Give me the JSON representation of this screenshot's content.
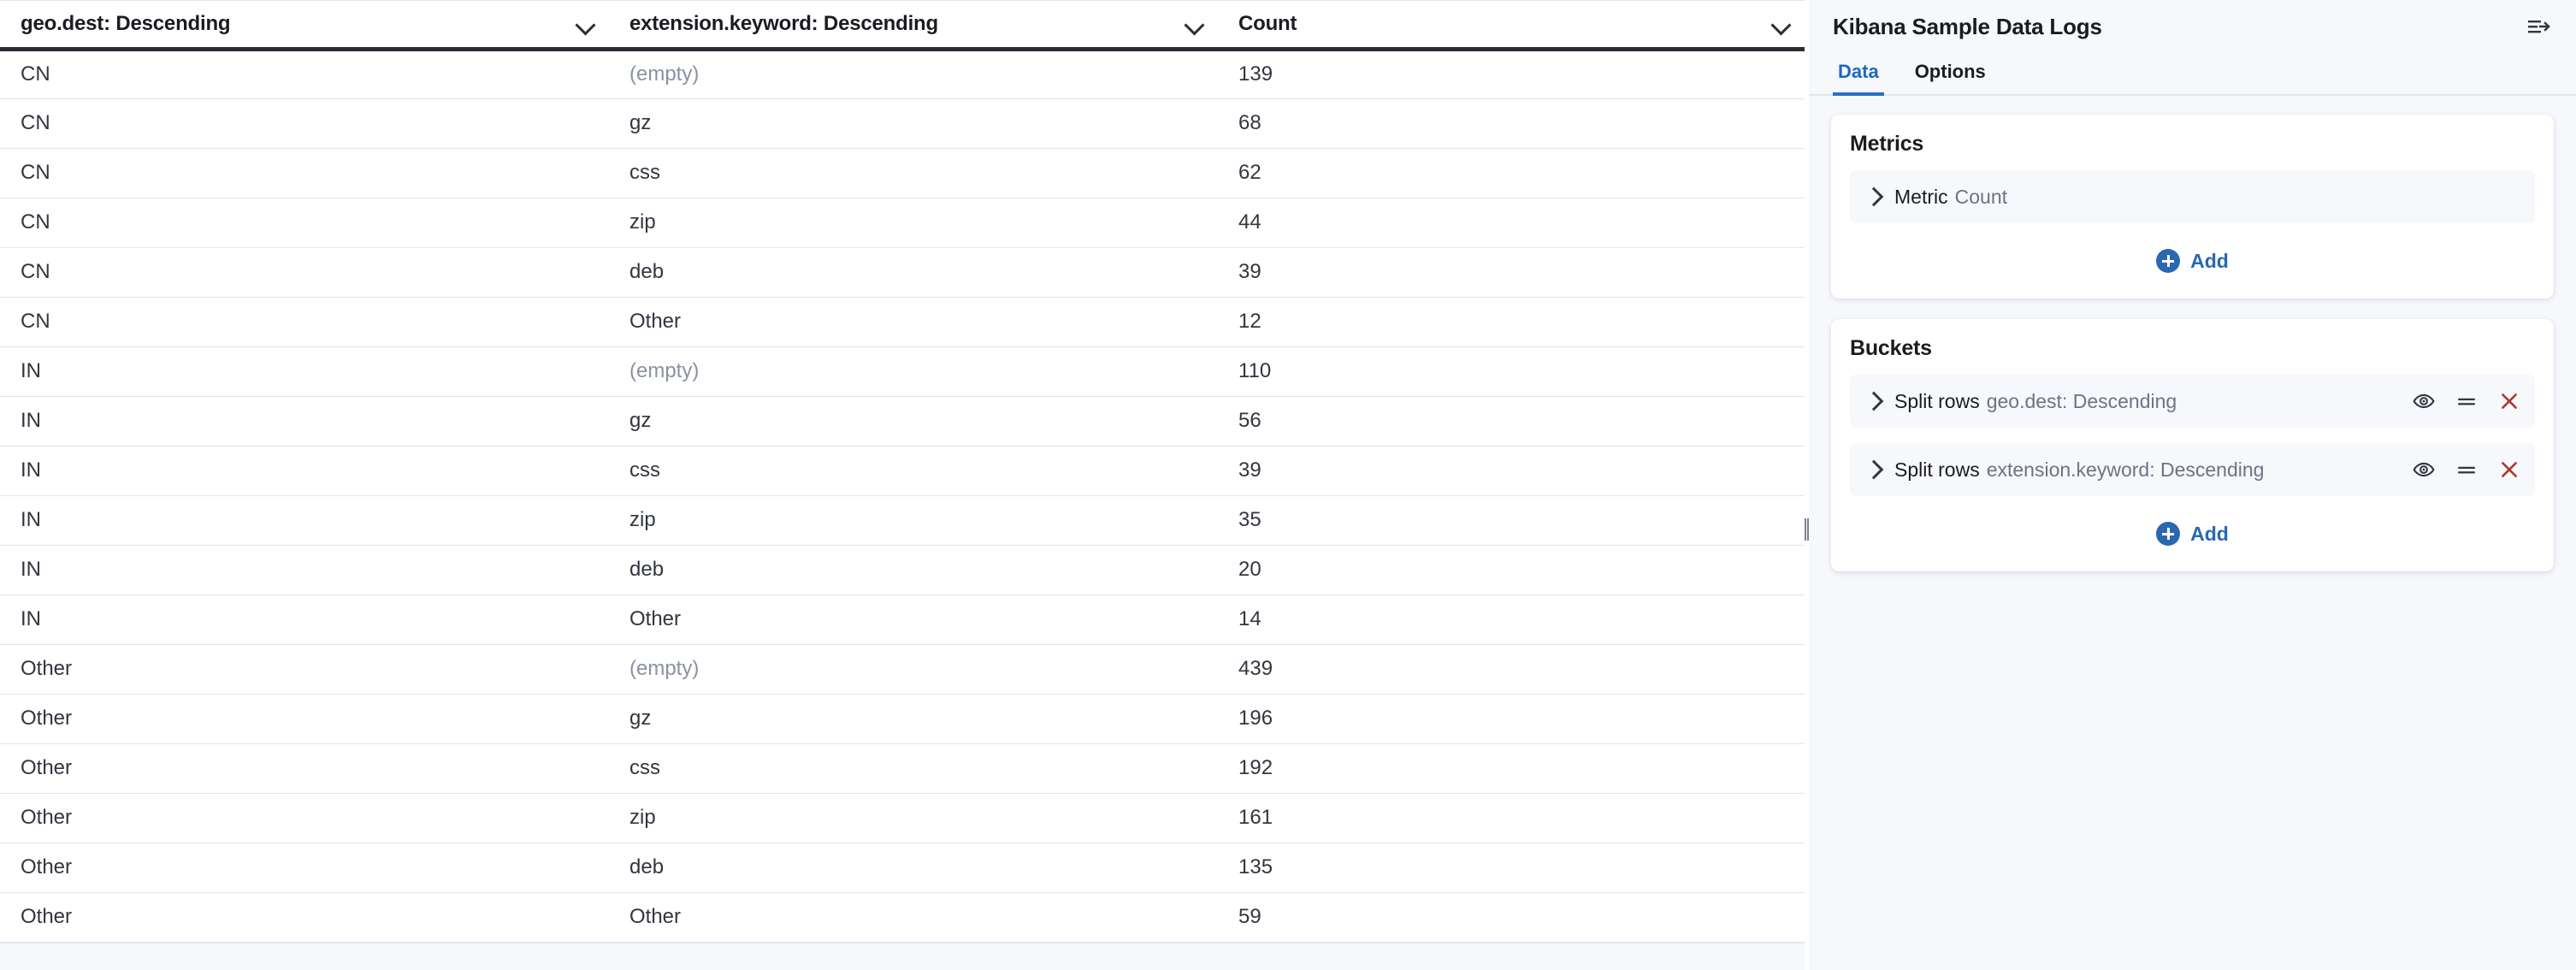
{
  "table": {
    "columns": [
      {
        "label": "geo.dest: Descending",
        "sort_icon": "chevron-down-icon"
      },
      {
        "label": "extension.keyword: Descending",
        "sort_icon": "chevron-down-icon"
      },
      {
        "label": "Count",
        "sort_icon": "chevron-down-icon"
      }
    ],
    "rows": [
      {
        "geo": "CN",
        "extension": "(empty)",
        "count": "139",
        "empty": true
      },
      {
        "geo": "CN",
        "extension": "gz",
        "count": "68",
        "empty": false
      },
      {
        "geo": "CN",
        "extension": "css",
        "count": "62",
        "empty": false
      },
      {
        "geo": "CN",
        "extension": "zip",
        "count": "44",
        "empty": false
      },
      {
        "geo": "CN",
        "extension": "deb",
        "count": "39",
        "empty": false
      },
      {
        "geo": "CN",
        "extension": "Other",
        "count": "12",
        "empty": false
      },
      {
        "geo": "IN",
        "extension": "(empty)",
        "count": "110",
        "empty": true
      },
      {
        "geo": "IN",
        "extension": "gz",
        "count": "56",
        "empty": false
      },
      {
        "geo": "IN",
        "extension": "css",
        "count": "39",
        "empty": false
      },
      {
        "geo": "IN",
        "extension": "zip",
        "count": "35",
        "empty": false
      },
      {
        "geo": "IN",
        "extension": "deb",
        "count": "20",
        "empty": false
      },
      {
        "geo": "IN",
        "extension": "Other",
        "count": "14",
        "empty": false
      },
      {
        "geo": "Other",
        "extension": "(empty)",
        "count": "439",
        "empty": true
      },
      {
        "geo": "Other",
        "extension": "gz",
        "count": "196",
        "empty": false
      },
      {
        "geo": "Other",
        "extension": "css",
        "count": "192",
        "empty": false
      },
      {
        "geo": "Other",
        "extension": "zip",
        "count": "161",
        "empty": false
      },
      {
        "geo": "Other",
        "extension": "deb",
        "count": "135",
        "empty": false
      },
      {
        "geo": "Other",
        "extension": "Other",
        "count": "59",
        "empty": false
      }
    ]
  },
  "config": {
    "title": "Kibana Sample Data Logs",
    "collapse_icon": "collapse-panel-icon",
    "tabs": [
      {
        "label": "Data",
        "active": true
      },
      {
        "label": "Options",
        "active": false
      }
    ],
    "metrics": {
      "title": "Metrics",
      "items": [
        {
          "label": "Metric",
          "value": "Count",
          "expand_icon": "chevron-right-icon"
        }
      ],
      "add_label": "Add",
      "add_icon": "plus-circle-icon"
    },
    "buckets": {
      "title": "Buckets",
      "items": [
        {
          "label": "Split rows",
          "value": "geo.dest: Descending",
          "expand_icon": "chevron-right-icon",
          "actions": [
            "eye-icon",
            "drag-handle-icon",
            "remove-icon"
          ]
        },
        {
          "label": "Split rows",
          "value": "extension.keyword: Descending",
          "expand_icon": "chevron-right-icon",
          "actions": [
            "eye-icon",
            "drag-handle-icon",
            "remove-icon"
          ]
        }
      ],
      "add_label": "Add",
      "add_icon": "plus-circle-icon"
    }
  },
  "colors": {
    "accent_blue": "#2a67b1",
    "tab_active_blue": "#1c68c4",
    "remove_red": "#a83a30",
    "text_dark": "#1a1c21",
    "text_muted": "#6d7384",
    "panel_bg": "#f7f8fc",
    "row_border": "#dfe5f0"
  },
  "chart_data": {
    "type": "table",
    "title": "Kibana Sample Data Logs",
    "columns": [
      "geo.dest: Descending",
      "extension.keyword: Descending",
      "Count"
    ],
    "rows": [
      [
        "CN",
        "(empty)",
        139
      ],
      [
        "CN",
        "gz",
        68
      ],
      [
        "CN",
        "css",
        62
      ],
      [
        "CN",
        "zip",
        44
      ],
      [
        "CN",
        "deb",
        39
      ],
      [
        "CN",
        "Other",
        12
      ],
      [
        "IN",
        "(empty)",
        110
      ],
      [
        "IN",
        "gz",
        56
      ],
      [
        "IN",
        "css",
        39
      ],
      [
        "IN",
        "zip",
        35
      ],
      [
        "IN",
        "deb",
        20
      ],
      [
        "IN",
        "Other",
        14
      ],
      [
        "Other",
        "(empty)",
        439
      ],
      [
        "Other",
        "gz",
        196
      ],
      [
        "Other",
        "css",
        192
      ],
      [
        "Other",
        "zip",
        161
      ],
      [
        "Other",
        "deb",
        135
      ],
      [
        "Other",
        "Other",
        59
      ]
    ]
  }
}
